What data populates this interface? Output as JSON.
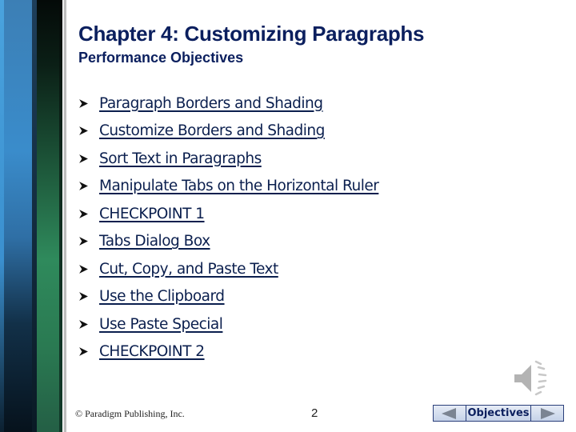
{
  "slide": {
    "title": "Chapter 4: Customizing Paragraphs",
    "subtitle": "Performance Objectives",
    "objectives": [
      "Paragraph Borders and Shading",
      "Customize Borders and Shading",
      "Sort Text in Paragraphs",
      "Manipulate Tabs on the Horizontal Ruler",
      "CHECKPOINT 1",
      "Tabs Dialog Box",
      "Cut, Copy, and Paste Text",
      "Use the Clipboard",
      "Use Paste Special",
      "CHECKPOINT 2"
    ],
    "bullet_icon": "arrow-bullet-icon",
    "audio_icon": "speaker-icon"
  },
  "footer": {
    "copyright": "© Paradigm Publishing, Inc.",
    "page_number": "2"
  },
  "nav": {
    "prev_icon": "triangle-left-icon",
    "label": "Objectives",
    "next_icon": "triangle-right-icon"
  },
  "colors": {
    "title": "#0b1f5e",
    "link": "#0b1f4e",
    "sidebar_blue": "#3a8ccb",
    "sidebar_green": "#2f8a5c"
  }
}
